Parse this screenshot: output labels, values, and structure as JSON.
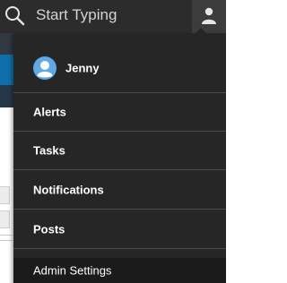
{
  "search": {
    "placeholder": "Start Typing",
    "icon": "search-icon"
  },
  "user_button": {
    "icon": "user-icon"
  },
  "menu": {
    "user": {
      "name": "Jenny",
      "icon": "avatar-icon"
    },
    "items": [
      {
        "label": "Alerts"
      },
      {
        "label": "Tasks"
      },
      {
        "label": "Notifications"
      },
      {
        "label": "Posts"
      },
      {
        "label": "Admin Settings"
      }
    ]
  },
  "colors": {
    "topbar": "#2c2c2c",
    "menu_bg": "#262626",
    "menu_separator": "#4a4a4a",
    "avatar_bg": "#5ea9e6",
    "page_accent": "#0f6faa"
  }
}
